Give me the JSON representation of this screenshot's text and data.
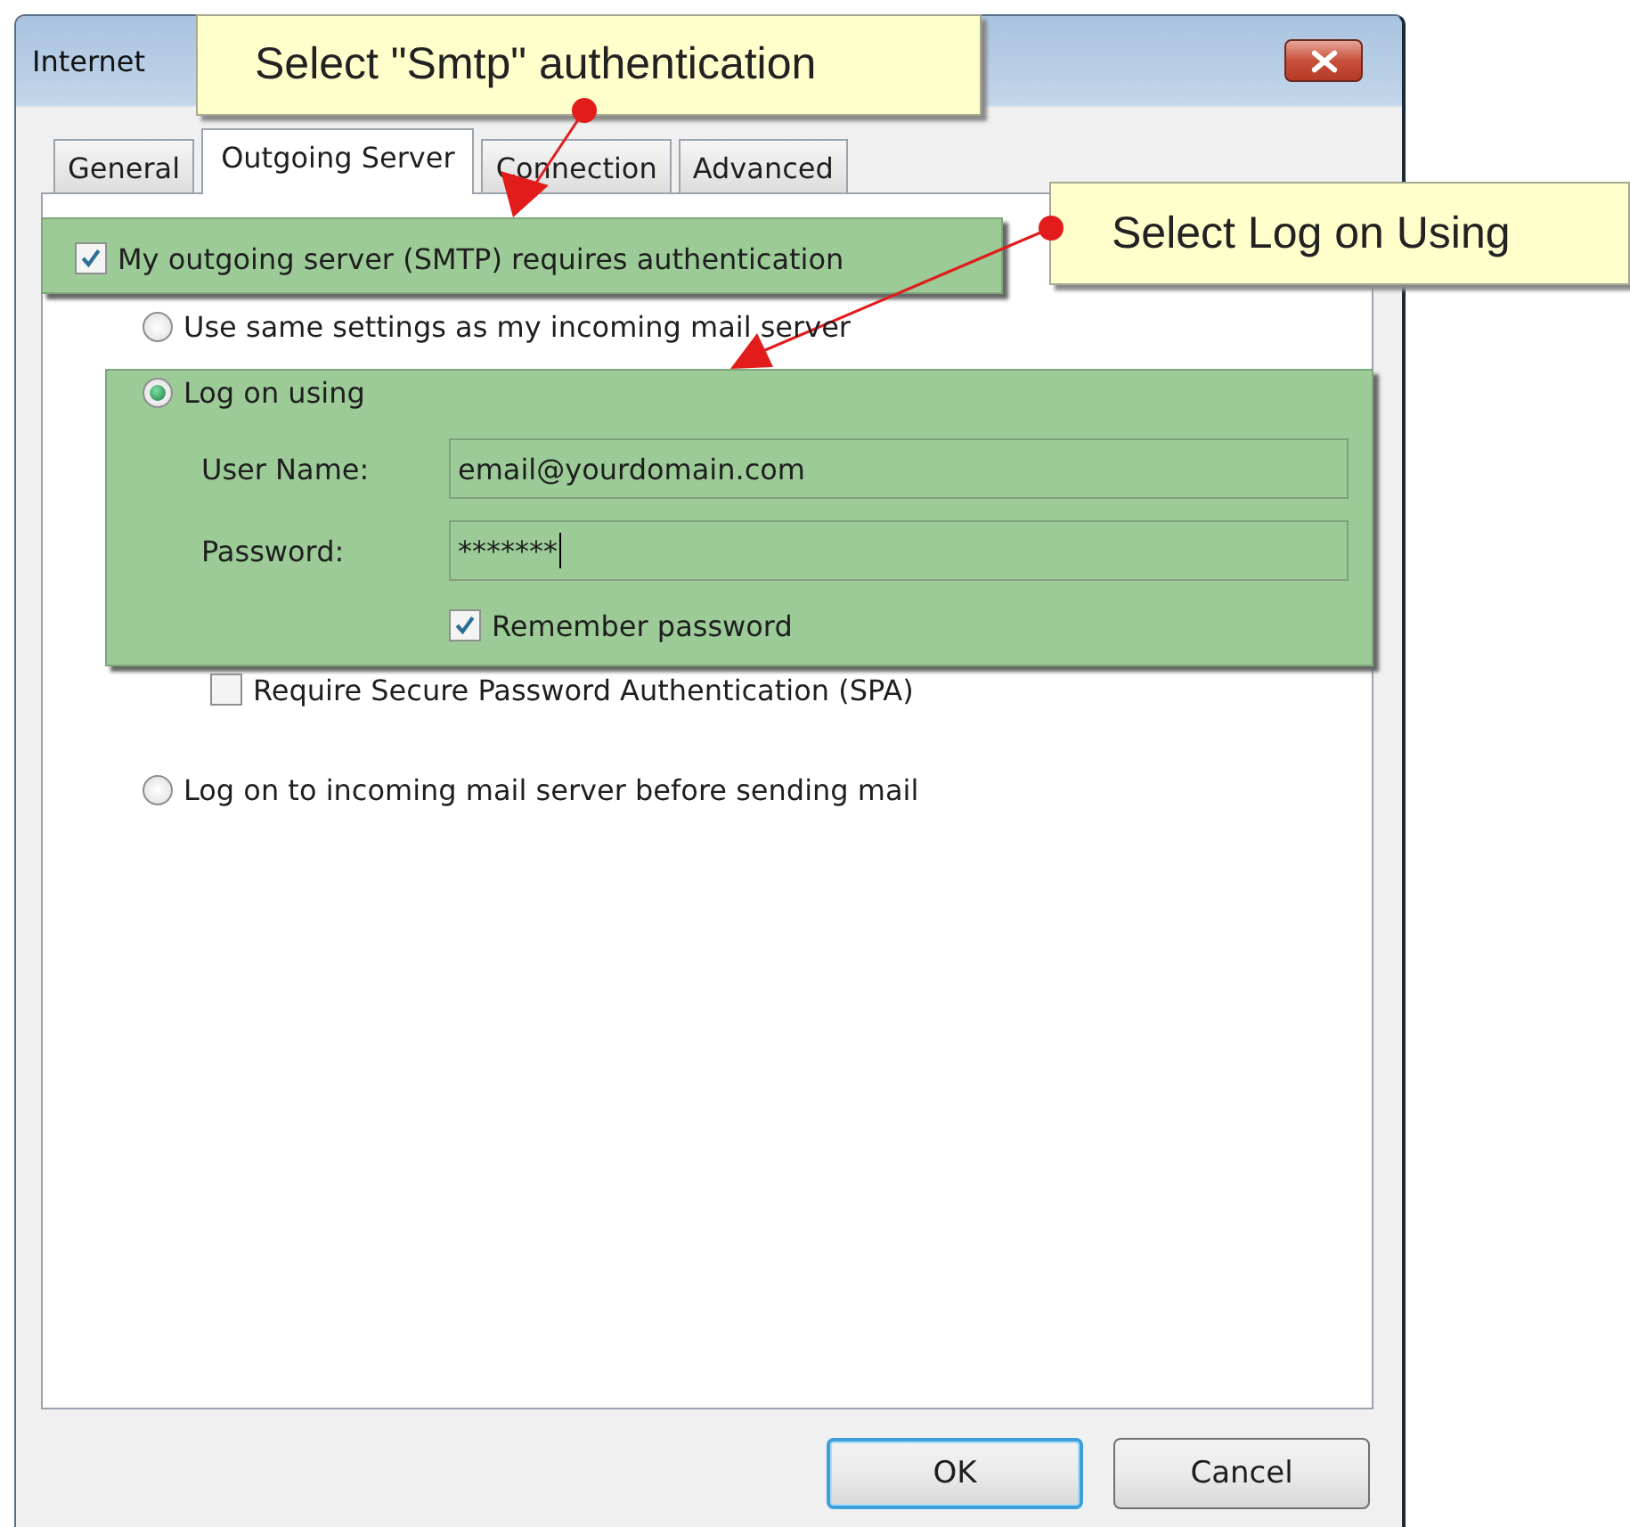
{
  "window": {
    "title": "Internet"
  },
  "tabs": [
    {
      "label": "General",
      "selected": false
    },
    {
      "label": "Outgoing Server",
      "selected": true
    },
    {
      "label": "Connection",
      "selected": false
    },
    {
      "label": "Advanced",
      "selected": false
    }
  ],
  "smtp_auth": {
    "label": "My outgoing server (SMTP) requires authentication",
    "checked": true
  },
  "auth_methods": [
    {
      "label": "Use same settings as my incoming mail server",
      "selected": false
    },
    {
      "label": "Log on using",
      "selected": true
    },
    {
      "label": "Log on to incoming mail server before sending mail",
      "selected": false
    }
  ],
  "logon": {
    "user_name": {
      "label": "User Name:",
      "value": "email@yourdomain.com"
    },
    "password": {
      "label": "Password:",
      "value": "*******"
    },
    "remember_password": {
      "label": "Remember password",
      "checked": true
    },
    "spa": {
      "label": "Require Secure Password Authentication (SPA)",
      "checked": false
    }
  },
  "buttons": [
    {
      "label": "OK",
      "default": true
    },
    {
      "label": "Cancel",
      "default": false
    }
  ],
  "callouts": [
    {
      "text": "Select \"Smtp\" authentication"
    },
    {
      "text": "Select Log on Using"
    }
  ]
}
